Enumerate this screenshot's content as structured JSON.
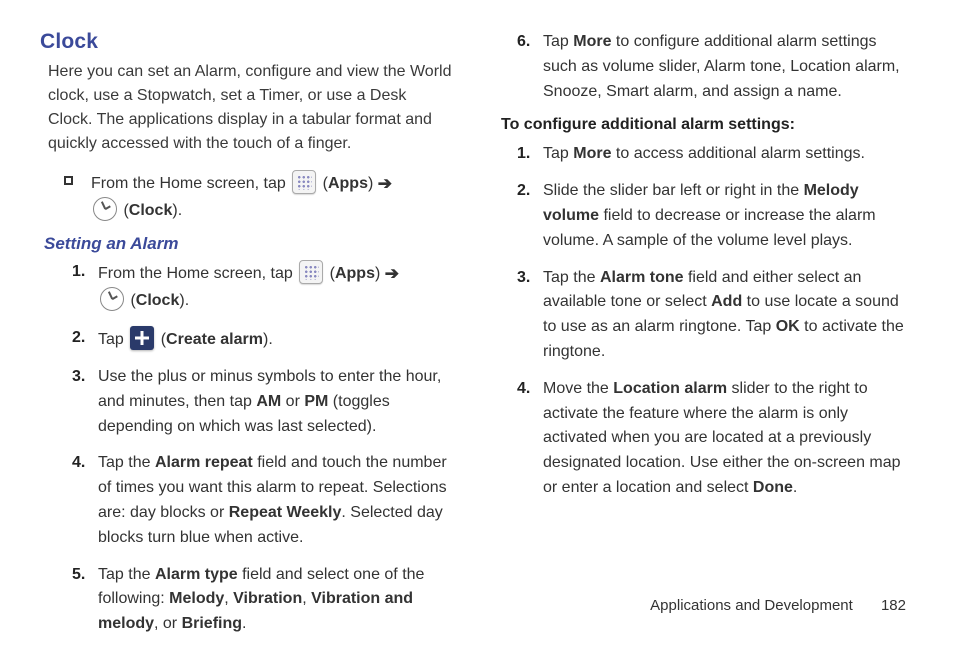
{
  "heading": "Clock",
  "intro": "Here you can set an Alarm, configure and view the World clock, use a Stopwatch, set a Timer, or use a Desk Clock. The applications display in a tabular format and quickly accessed with the touch of a finger.",
  "from_home_prefix": "From the Home screen, tap ",
  "apps_label": "Apps",
  "clock_label": "Clock",
  "subheading": "Setting an Alarm",
  "steps_left": {
    "1": {
      "num": "1.",
      "prefix": "From the Home screen, tap "
    },
    "2": {
      "num": "2.",
      "prefix": "Tap ",
      "create": "Create alarm"
    },
    "3": {
      "num": "3.",
      "t1": "Use the plus or minus symbols to enter the hour, and minutes, then tap ",
      "am": "AM",
      "t2": " or ",
      "pm": "PM",
      "t3": " (toggles depending on which was last selected)."
    },
    "4": {
      "num": "4.",
      "t1": "Tap the ",
      "ar": "Alarm repeat",
      "t2": " field and touch the number of times you want this alarm to repeat. Selections are: day blocks or ",
      "rw": "Repeat Weekly",
      "t3": ". Selected day blocks turn blue when active."
    },
    "5": {
      "num": "5.",
      "t1": "Tap the ",
      "at": "Alarm type",
      "t2": " field and select one of the following: ",
      "m": "Melody",
      "c1": ", ",
      "v": "Vibration",
      "c2": ", ",
      "vm": "Vibration and melody",
      "c3": ", or ",
      "br": "Briefing",
      "end": "."
    }
  },
  "step6": {
    "num": "6.",
    "t1": "Tap ",
    "more": "More",
    "t2": " to configure additional alarm settings such as volume slider, Alarm tone, Location alarm, Snooze, Smart alarm, and assign a name."
  },
  "subtitle2": "To configure additional alarm settings:",
  "steps_right": {
    "1": {
      "num": "1.",
      "t1": "Tap ",
      "more": "More",
      "t2": " to access additional alarm settings."
    },
    "2": {
      "num": "2.",
      "t1": "Slide the slider bar left or right in the ",
      "mv": "Melody volume",
      "t2": " field to decrease or increase the alarm volume. A sample of the volume level plays."
    },
    "3": {
      "num": "3.",
      "t1": "Tap the ",
      "at": "Alarm tone",
      "t2": " field and either select an available tone or select ",
      "add": "Add",
      "t3": " to use locate a sound to use as an alarm ringtone. Tap ",
      "ok": "OK",
      "t4": " to activate the ringtone."
    },
    "4": {
      "num": "4.",
      "t1": "Move the ",
      "la": "Location alarm",
      "t2": " slider to the right to activate the feature where the alarm is only activated when you are located at a previously designated location. Use either the on-screen map or enter a location and select ",
      "done": "Done",
      "end": "."
    }
  },
  "footer_section": "Applications and Development",
  "footer_page": "182"
}
